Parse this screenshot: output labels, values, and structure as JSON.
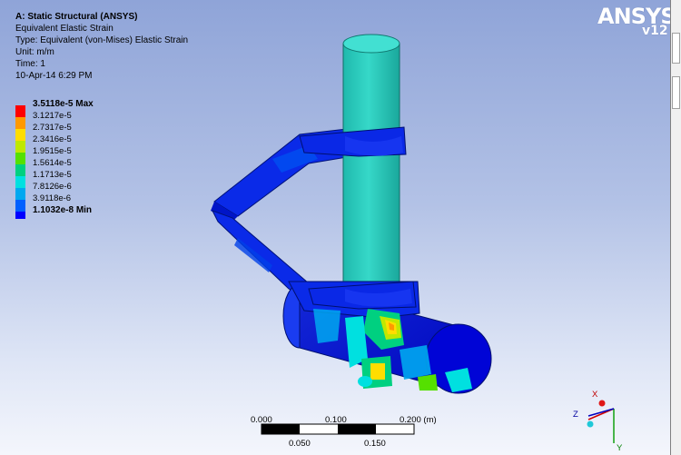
{
  "info": {
    "title": "A: Static Structural (ANSYS)",
    "result_name": "Equivalent Elastic Strain",
    "type_line": "Type: Equivalent (von-Mises) Elastic Strain",
    "unit_line": "Unit: m/m",
    "time_line": "Time: 1",
    "date_line": "10-Apr-14 6:29 PM"
  },
  "legend": {
    "entries": [
      {
        "label": "3.5118e-5 Max",
        "color": "#ff0000"
      },
      {
        "label": "3.1217e-5",
        "color": "#ff9900"
      },
      {
        "label": "2.7317e-5",
        "color": "#ffdd00"
      },
      {
        "label": "2.3416e-5",
        "color": "#bfe800"
      },
      {
        "label": "1.9515e-5",
        "color": "#55e000"
      },
      {
        "label": "1.5614e-5",
        "color": "#00d080"
      },
      {
        "label": "1.1713e-5",
        "color": "#00e0e0"
      },
      {
        "label": "7.8126e-6",
        "color": "#00a8f0"
      },
      {
        "label": "3.9118e-6",
        "color": "#0060ff"
      },
      {
        "label": "1.1032e-8 Min",
        "color": "#0000ff"
      }
    ]
  },
  "logo": {
    "brand": "ANSYS",
    "version": "v12"
  },
  "scale_bar": {
    "top_labels": [
      "0.000",
      "0.100",
      "0.200 (m)"
    ],
    "bottom_labels": [
      "0.050",
      "0.150"
    ]
  },
  "triad": {
    "x_label": "X",
    "y_label": "Y",
    "z_label": "Z"
  },
  "colors": {
    "accent_min": "#0000ff",
    "accent_max": "#ff0000",
    "post_color": "#2ecfc0",
    "background_top": "#8fa4d8"
  }
}
